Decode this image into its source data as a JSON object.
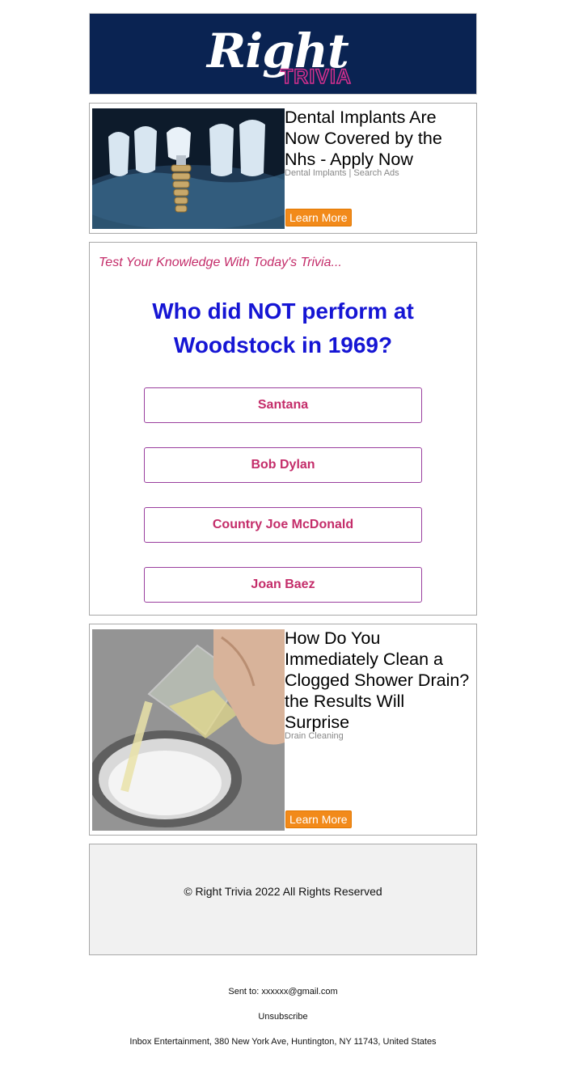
{
  "header": {
    "logo_word": "Right",
    "logo_sub": "TRIVIA"
  },
  "ads": [
    {
      "title": "Dental Implants Are Now Covered by the Nhs - Apply Now",
      "source": "Dental Implants | Search Ads",
      "button": "Learn More"
    },
    {
      "title": "How Do You Immediately Clean a Clogged Shower Drain? the Results Will Surprise",
      "source": "Drain Cleaning",
      "button": "Learn More"
    }
  ],
  "trivia": {
    "tagline": "Test Your Knowledge With Today's Trivia...",
    "question": "Who did NOT perform at Woodstock in 1969?",
    "answers": [
      "Santana",
      "Bob Dylan",
      "Country Joe McDonald",
      "Joan Baez"
    ]
  },
  "footer": {
    "copyright": "© Right Trivia 2022 All Rights Reserved",
    "sent_to": "Sent to: xxxxxx@gmail.com",
    "unsubscribe": "Unsubscribe",
    "address": "Inbox Entertainment, 380 New York Ave, Huntington, NY 11743, United States"
  },
  "colors": {
    "header_bg": "#0a2352",
    "accent_pink": "#c42d6a",
    "question_blue": "#1515d4",
    "button_orange": "#f28a1a"
  }
}
